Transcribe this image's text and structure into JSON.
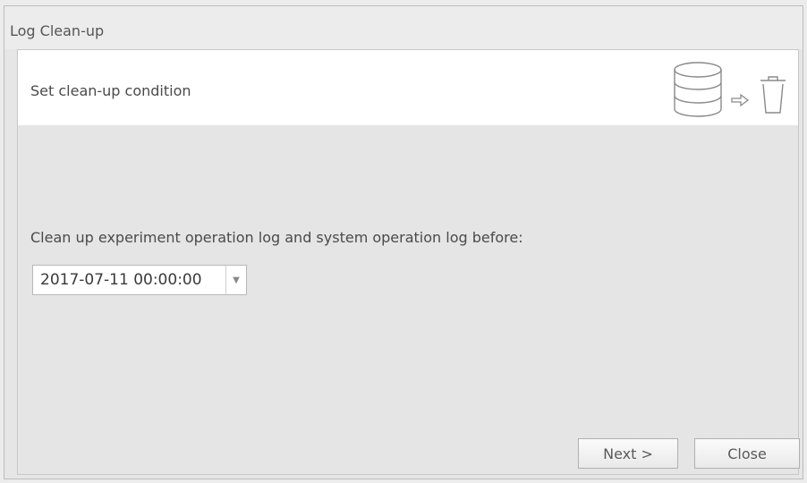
{
  "window": {
    "title": "Log Clean-up"
  },
  "header": {
    "text": "Set clean-up condition",
    "icons": [
      "database-icon",
      "arrow-right-icon",
      "trash-icon"
    ]
  },
  "main": {
    "prompt": "Clean up experiment operation log and system operation log before:",
    "date_value": "2017-07-11 00:00:00",
    "dropdown_icon": "chevron-down-icon"
  },
  "buttons": {
    "next_label": "Next >",
    "close_label": "Close"
  },
  "colors": {
    "background": "#e5e5e5",
    "header_band": "#ffffff",
    "text": "#4a4a4a"
  }
}
